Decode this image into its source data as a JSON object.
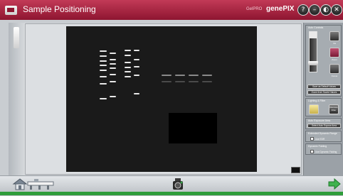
{
  "window": {
    "title": "Sample Positioning",
    "brand_small": "GelPRO",
    "brand_name": "genePIX",
    "controls": [
      "?",
      "–",
      "◐",
      "✕"
    ]
  },
  "right_panel": {
    "camera_group": {
      "header": "Auto Controls",
      "buttons": [
        {
          "icon": "iris-icon",
          "label": "Iris"
        },
        {
          "icon": "zoom-icon",
          "label": "Zoom"
        },
        {
          "icon": "focus-icon",
          "label": "Focus"
        }
      ],
      "save_default": "Save as Default Values",
      "zoom_from_saved": "Zoom from Saved Values"
    },
    "lighting_group": {
      "header": "Lighting & Filter",
      "remove_filter": "Remove Filter"
    },
    "auto_exposure_group": {
      "header": "Auto Exposure Area",
      "select_button": "Select Auto Expose Area"
    },
    "dynamic_range_group": {
      "header": "Extended Dynamic Range",
      "checkbox_label": "Use EDR"
    },
    "dynamic_folding_group": {
      "header": "Dynamic Folding",
      "checkbox_label": "Use Dynamic Folding"
    }
  },
  "colors": {
    "title_bar": "#a31f3d",
    "gel_background": "#1a1a1a",
    "band": "#e8e8e8",
    "accent_green": "#2e9d3a"
  },
  "icons": {
    "home": "home-icon",
    "ruler": "ruler-icon",
    "camera": "camera-icon",
    "next": "next-arrow-icon"
  }
}
